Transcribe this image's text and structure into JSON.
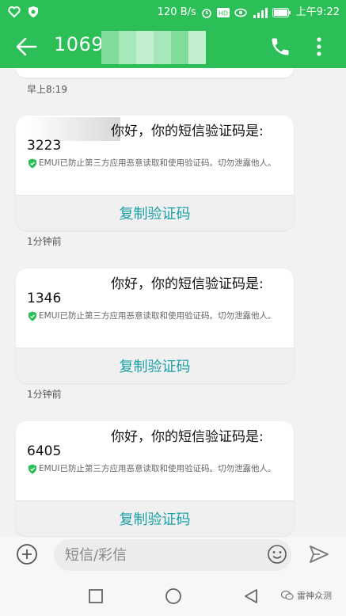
{
  "status_bar": {
    "net_speed": "120 B/s",
    "time": "上午9:22",
    "icons": [
      "heart-icon",
      "shield-icon",
      "alarm-icon",
      "hd-icon",
      "eye-icon",
      "signal-icon",
      "battery-icon"
    ]
  },
  "header": {
    "title": "1069",
    "icons": [
      "back-arrow-icon",
      "phone-icon",
      "more-vertical-icon"
    ]
  },
  "conversation": {
    "top_time": "早上8:19",
    "messages": [
      {
        "greeting": "你好，你的短信验证码是:",
        "code": "3223",
        "warning": "EMUI已防止第三方应用恶意读取和使用验证码。切勿泄露他人。",
        "copy_label": "复制验证码",
        "time": "1分钟前"
      },
      {
        "greeting": "你好，你的短信验证码是:",
        "code": "1346",
        "warning": "EMUI已防止第三方应用恶意读取和使用验证码。切勿泄露他人。",
        "copy_label": "复制验证码",
        "time": "1分钟前"
      },
      {
        "greeting": "你好，你的短信验证码是:",
        "code": "6405",
        "warning": "EMUI已防止第三方应用恶意读取和使用验证码。切勿泄露他人。",
        "copy_label": "复制验证码"
      }
    ]
  },
  "composer": {
    "placeholder": "短信/彩信"
  },
  "watermark": "雷神众测",
  "colors": {
    "brand": "#2cbf57",
    "copy_text": "#1aa0a8",
    "shield": "#2cbf57"
  }
}
